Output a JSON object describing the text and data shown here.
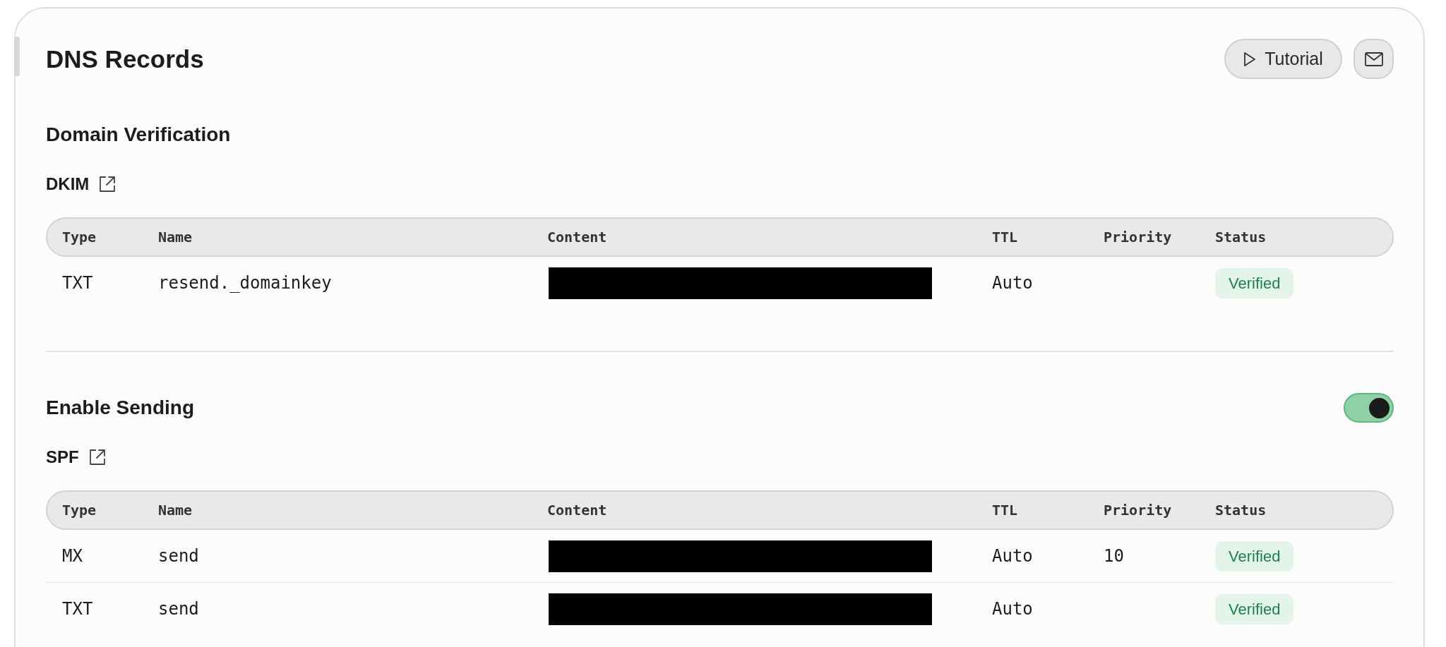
{
  "header": {
    "title": "DNS Records",
    "tutorial_button": {
      "label": "Tutorial"
    }
  },
  "sections": [
    {
      "title": "Domain Verification",
      "records": [
        {
          "label": "DKIM",
          "columns": [
            "Type",
            "Name",
            "Content",
            "TTL",
            "Priority",
            "Status"
          ],
          "rows": [
            {
              "type": "TXT",
              "name": "resend._domainkey",
              "content_redacted": true,
              "ttl": "Auto",
              "status": "Verified"
            }
          ]
        }
      ]
    },
    {
      "title": "Enable Sending",
      "toggle": {
        "on": true
      },
      "records": [
        {
          "label": "SPF",
          "columns": [
            "Type",
            "Name",
            "Content",
            "TTL",
            "Priority",
            "Status"
          ],
          "rows": [
            {
              "type": "MX",
              "name": "send",
              "content_redacted": true,
              "ttl": "Auto",
              "priority": "10",
              "status": "Verified"
            },
            {
              "type": "TXT",
              "name": "send",
              "content_redacted": true,
              "ttl": "Auto",
              "status": "Verified"
            }
          ]
        }
      ]
    }
  ]
}
